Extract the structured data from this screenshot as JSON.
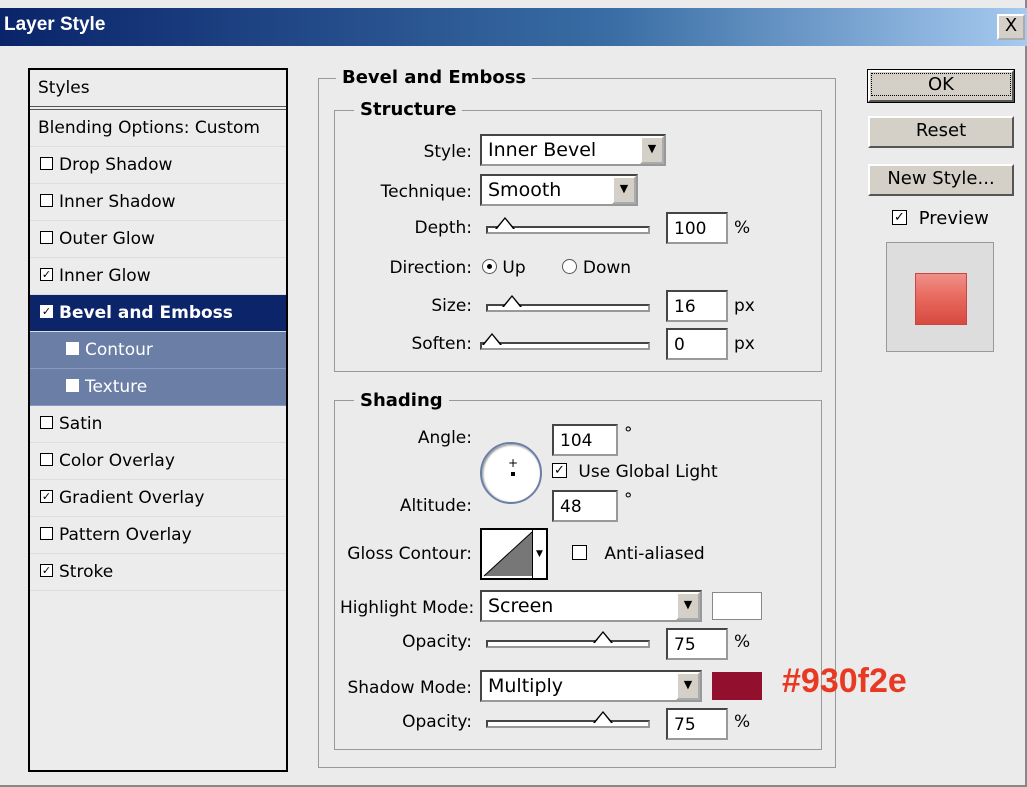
{
  "window": {
    "title": "Layer Style",
    "close_label": "X"
  },
  "style_list": {
    "header": "Styles",
    "blending": "Blending Options: Custom",
    "items": [
      {
        "label": "Drop Shadow",
        "checked": false
      },
      {
        "label": "Inner Shadow",
        "checked": false
      },
      {
        "label": "Outer Glow",
        "checked": false
      },
      {
        "label": "Inner Glow",
        "checked": true
      },
      {
        "label": "Bevel and Emboss",
        "checked": true
      },
      {
        "label": "Contour",
        "checked": false
      },
      {
        "label": "Texture",
        "checked": false
      },
      {
        "label": "Satin",
        "checked": false
      },
      {
        "label": "Color Overlay",
        "checked": false
      },
      {
        "label": "Gradient Overlay",
        "checked": true
      },
      {
        "label": "Pattern Overlay",
        "checked": false
      },
      {
        "label": "Stroke",
        "checked": true
      }
    ]
  },
  "bevel": {
    "group_title": "Bevel and Emboss",
    "structure": {
      "title": "Structure",
      "style_label": "Style:",
      "style_value": "Inner Bevel",
      "technique_label": "Technique:",
      "technique_value": "Smooth",
      "depth_label": "Depth:",
      "depth_value": "100",
      "depth_unit": "%",
      "depth_level": 0.05,
      "direction_label": "Direction:",
      "direction_up": "Up",
      "direction_down": "Down",
      "size_label": "Size:",
      "size_value": "16",
      "size_unit": "px",
      "size_level": 0.1,
      "soften_label": "Soften:",
      "soften_value": "0",
      "soften_unit": "px",
      "soften_level": 0
    },
    "shading": {
      "title": "Shading",
      "angle_label": "Angle:",
      "angle_value": "104",
      "angle_unit": "°",
      "global_light_label": "Use Global Light",
      "altitude_label": "Altitude:",
      "altitude_value": "48",
      "altitude_unit": "°",
      "gloss_label": "Gloss Contour:",
      "anti_aliased_label": "Anti-aliased",
      "highlight_label": "Highlight Mode:",
      "highlight_value": "Screen",
      "highlight_color": "#ffffff",
      "highlight_opacity_label": "Opacity:",
      "highlight_opacity": "75",
      "highlight_opacity_unit": "%",
      "highlight_opacity_level": 0.75,
      "shadow_label": "Shadow Mode:",
      "shadow_value": "Multiply",
      "shadow_color": "#930f2e",
      "shadow_opacity_label": "Opacity:",
      "shadow_opacity": "75",
      "shadow_opacity_unit": "%",
      "shadow_opacity_level": 0.75
    }
  },
  "buttons": {
    "ok": "OK",
    "reset": "Reset",
    "new_style": "New Style...",
    "preview": "Preview"
  },
  "annotation": {
    "hex": "#930f2e"
  }
}
